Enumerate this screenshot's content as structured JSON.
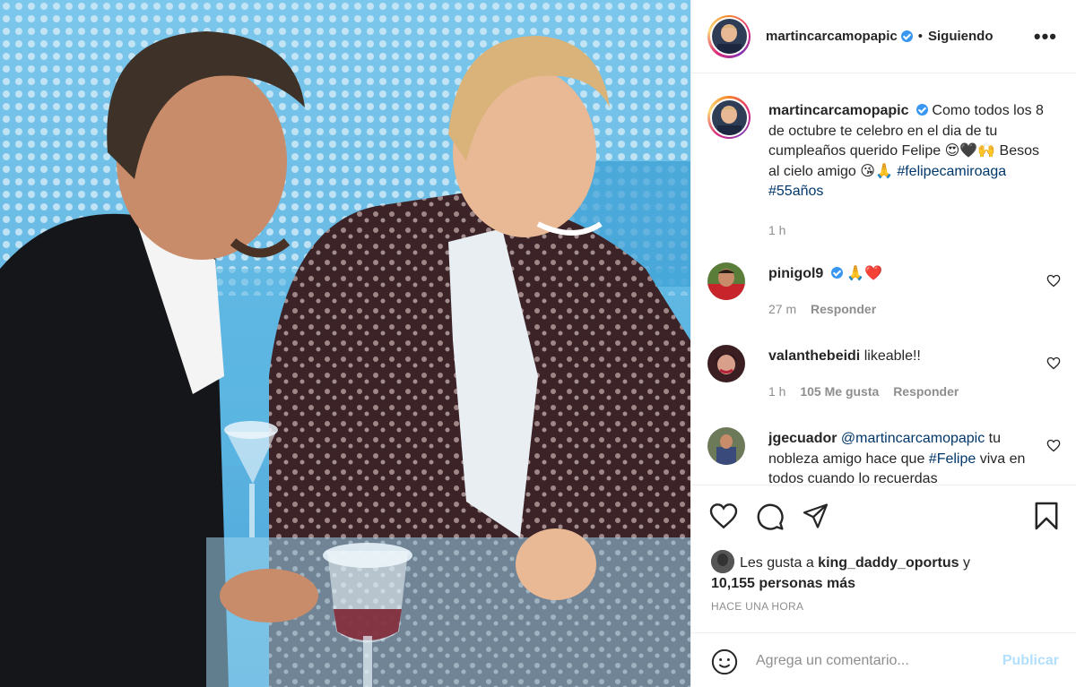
{
  "post": {
    "author": "martincarcamopapic",
    "follow_state": "Siguiendo",
    "dot": "•",
    "more": "•••"
  },
  "caption": {
    "user": "martincarcamopapic",
    "text": "Como todos los 8 de octubre te celebro en el dia de tu cumpleaños querido Felipe 😍🖤🙌 Besos al cielo amigo 😘🙏",
    "hashtags": "#felipecamiroaga #55años",
    "time": "1 h"
  },
  "comments": [
    {
      "user": "pinigol9",
      "verified": true,
      "text": "🙏❤️",
      "time": "27 m",
      "likes": "",
      "reply": "Responder"
    },
    {
      "user": "valanthebeidi",
      "verified": false,
      "text": "likeable!!",
      "time": "1 h",
      "likes": "105 Me gusta",
      "reply": "Responder"
    },
    {
      "user": "jgecuador",
      "verified": false,
      "mention": "@martincarcamopapic",
      "text_before": " tu nobleza amigo hace que ",
      "hashtag": "#Felipe",
      "text_after": " viva en todos cuando lo recuerdas"
    }
  ],
  "likes": {
    "prefix": "Les gusta a ",
    "user": "king_daddy_oportus",
    "suffix": " y",
    "count": "10,155 personas más"
  },
  "timestamp": "HACE UNA HORA",
  "composer": {
    "placeholder": "Agrega un comentario...",
    "publish": "Publicar"
  },
  "icons": {
    "like": "heart-icon",
    "comment": "comment-icon",
    "share": "paper-plane-icon",
    "save": "bookmark-icon",
    "emoji": "smiley-icon"
  },
  "colors": {
    "link": "#00376b",
    "verified": "#3897f0",
    "muted": "#8e8e8e",
    "publish_disabled": "#b2dffc"
  }
}
